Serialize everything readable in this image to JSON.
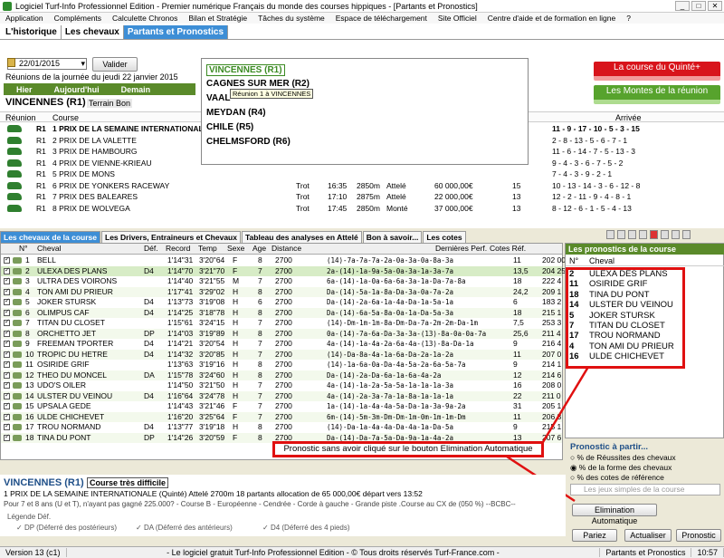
{
  "window": {
    "title": "Logiciel Turf-Info Professionnel Edition - Premier numérique Français du monde des courses hippiques - [Partants et Pronostics]"
  },
  "menu": [
    "Application",
    "Compléments",
    "Calculette Chronos",
    "Bilan et Stratégie",
    "Tâches du système",
    "Espace de téléchargement",
    "Site Officiel",
    "Centre d'aide et de formation en ligne",
    "?"
  ],
  "tabs": [
    "L'historique",
    "Les chevaux",
    "Partants et Pronostics"
  ],
  "date": {
    "value": "22/01/2015",
    "valider": "Valider"
  },
  "reunions_text": "Réunions de la journée du jeudi 22 janvier 2015",
  "nav": {
    "hier": "Hier",
    "aujourdhui": "Aujourd'hui",
    "demain": "Demain"
  },
  "venue": {
    "title": "VINCENNES (R1)",
    "terrain": "Terrain Bon"
  },
  "race_table": {
    "headers": [
      "Réunion",
      "Course",
      "Arrivée"
    ],
    "rows": [
      {
        "reunion": "R1",
        "course": "1 PRIX DE LA SEMAINE INTERNATIONALE",
        "type": "",
        "time": "",
        "dist": "",
        "mode": "",
        "prize": "",
        "partants": "",
        "arrivee": "11 - 9 - 17 - 10 - 5 - 3 - 15"
      },
      {
        "reunion": "R1",
        "course": "2 PRIX DE LA VALETTE",
        "type": "",
        "time": "",
        "dist": "",
        "mode": "",
        "prize": "",
        "partants": "",
        "arrivee": "2 - 8 - 13 - 5 - 6 - 7 - 1"
      },
      {
        "reunion": "R1",
        "course": "3 PRIX DE HAMBOURG",
        "type": "",
        "time": "",
        "dist": "",
        "mode": "",
        "prize": "",
        "partants": "",
        "arrivee": "11 - 6 - 14 - 7 - 5 - 13 - 3"
      },
      {
        "reunion": "R1",
        "course": "4 PRIX DE VIENNE-KRIEAU",
        "type": "",
        "time": "",
        "dist": "",
        "mode": "",
        "prize": "",
        "partants": "",
        "arrivee": "9 - 4 - 3 - 6 - 7 - 5 - 2"
      },
      {
        "reunion": "R1",
        "course": "5 PRIX DE MONS",
        "type": "",
        "time": "",
        "dist": "",
        "mode": "",
        "prize": "",
        "partants": "",
        "arrivee": "7 - 4 - 3 - 9 - 2 - 1"
      },
      {
        "reunion": "R1",
        "course": "6 PRIX DE YONKERS RACEWAY",
        "type": "Trot",
        "time": "16:35",
        "dist": "2850m",
        "mode": "Attelé",
        "prize": "60 000,00€",
        "partants": "15",
        "arrivee": "10 - 13 - 14 - 3 - 6 - 12 - 8"
      },
      {
        "reunion": "R1",
        "course": "7 PRIX DES BALEARES",
        "type": "Trot",
        "time": "17:10",
        "dist": "2875m",
        "mode": "Attelé",
        "prize": "22 000,00€",
        "partants": "13",
        "arrivee": "12 - 2 - 11 - 9 - 4 - 8 - 1"
      },
      {
        "reunion": "R1",
        "course": "8 PRIX DE WOLVEGA",
        "type": "Trot",
        "time": "17:45",
        "dist": "2850m",
        "mode": "Monté",
        "prize": "37 000,00€",
        "partants": "13",
        "arrivee": "8 - 12 - 6 - 1 - 5 - 4 - 13"
      }
    ]
  },
  "popup": {
    "items": [
      "VINCENNES (R1)",
      "CAGNES SUR MER (R2)",
      "VAAL",
      "MEYDAN (R4)",
      "CHILE (R5)",
      "CHELMSFORD (R6)"
    ],
    "tooltip": "Réunion 1 à VINCENNES"
  },
  "quinte_button": "La course du Quinté+",
  "montes_button": "Les Montes de la réunion",
  "mid_tabs": [
    "Les chevaux de la course",
    "Les Drivers, Entraineurs et Chevaux",
    "Tableau des analyses en Attelé",
    "Bon à savoir...",
    "Les cotes"
  ],
  "horse_grid": {
    "headers": [
      "N°",
      "Cheval",
      "Déf.",
      "Record",
      "Temp",
      "Sexe",
      "Age",
      "Distance",
      "Dernières Perf.",
      "Cotes Réf."
    ],
    "rows": [
      {
        "n": "1",
        "name": "BELL",
        "def": "",
        "record": "1'14\"31",
        "temp": "3'20\"64",
        "sexe": "F",
        "age": "8",
        "dist": "2700",
        "perf": "(14)-7a-7a-7a-2a-0a-3a-0a-8a-3a",
        "cote": "11",
        "extra": "202 00"
      },
      {
        "n": "2",
        "name": "ULEXA DES PLANS",
        "def": "D4",
        "record": "1'14\"70",
        "temp": "3'21\"70",
        "sexe": "F",
        "age": "7",
        "dist": "2700",
        "perf": "2a-(14)-1a-9a-5a-0a-3a-1a-3a-7a",
        "cote": "13,5",
        "extra": "204 25"
      },
      {
        "n": "3",
        "name": "ULTRA DES VOIRONS",
        "def": "",
        "record": "1'14\"40",
        "temp": "3'21\"55",
        "sexe": "M",
        "age": "7",
        "dist": "2700",
        "perf": "6a-(14)-1a-0a-6a-6a-3a-1a-Da-7a-8a",
        "cote": "18",
        "extra": "222 4"
      },
      {
        "n": "4",
        "name": "TON AMI DU PRIEUR",
        "def": "",
        "record": "1'17\"41",
        "temp": "3'29\"02",
        "sexe": "H",
        "age": "8",
        "dist": "2700",
        "perf": "Da-(14)-5a-1a-8a-Da-3a-0a-7a-2a",
        "cote": "24,2",
        "extra": "209 1"
      },
      {
        "n": "5",
        "name": "JOKER STURSK",
        "def": "D4",
        "record": "1'13\"73",
        "temp": "3'19\"08",
        "sexe": "H",
        "age": "6",
        "dist": "2700",
        "perf": "Da-(14)-2a-6a-1a-4a-Da-1a-5a-1a",
        "cote": "6",
        "extra": "183 2"
      },
      {
        "n": "6",
        "name": "OLIMPUS CAF",
        "def": "D4",
        "record": "1'14\"25",
        "temp": "3'18\"78",
        "sexe": "H",
        "age": "8",
        "dist": "2700",
        "perf": "Da-(14)-6a-5a-8a-0a-1a-Da-5a-3a",
        "cote": "18",
        "extra": "215 1"
      },
      {
        "n": "7",
        "name": "TITAN DU CLOSET",
        "def": "",
        "record": "1'15\"61",
        "temp": "3'24\"15",
        "sexe": "H",
        "age": "7",
        "dist": "2700",
        "perf": "(14)-Dm-1m-1m-8a-Dm-Da-7a-2m-2m-Da-1m",
        "cote": "7,5",
        "extra": "253 3"
      },
      {
        "n": "8",
        "name": "ORCHETTO JET",
        "def": "DP",
        "record": "1'14\"03",
        "temp": "3'19\"89",
        "sexe": "H",
        "age": "8",
        "dist": "2700",
        "perf": "0a-(14)-7a-6a-Da-3a-3a-(13)-8a-0a-0a-7a",
        "cote": "25,6",
        "extra": "211 4"
      },
      {
        "n": "9",
        "name": "FREEMAN TPORTER",
        "def": "D4",
        "record": "1'14\"21",
        "temp": "3'20\"54",
        "sexe": "H",
        "age": "7",
        "dist": "2700",
        "perf": "4a-(14)-1a-4a-2a-6a-4a-(13)-8a-Da-1a",
        "cote": "9",
        "extra": "216 4"
      },
      {
        "n": "10",
        "name": "TROPIC DU HETRE",
        "def": "D4",
        "record": "1'14\"32",
        "temp": "3'20\"85",
        "sexe": "H",
        "age": "7",
        "dist": "2700",
        "perf": "(14)-Da-8a-4a-1a-6a-Da-2a-1a-2a",
        "cote": "11",
        "extra": "207 0"
      },
      {
        "n": "11",
        "name": "OSIRIDE GRIF",
        "def": "",
        "record": "1'13\"63",
        "temp": "3'19\"16",
        "sexe": "H",
        "age": "8",
        "dist": "2700",
        "perf": "(14)-1a-6a-0a-Da-4a-5a-2a-6a-5a-7a",
        "cote": "9",
        "extra": "214 1"
      },
      {
        "n": "12",
        "name": "THEO DU MONCEL",
        "def": "DA",
        "record": "1'15\"78",
        "temp": "3'24\"60",
        "sexe": "H",
        "age": "8",
        "dist": "2700",
        "perf": "Da-(14)-2a-Da-6a-1a-6a-4a-2a",
        "cote": "12",
        "extra": "214 6"
      },
      {
        "n": "13",
        "name": "UDO'S OILER",
        "def": "",
        "record": "1'14\"50",
        "temp": "3'21\"50",
        "sexe": "H",
        "age": "7",
        "dist": "2700",
        "perf": "4a-(14)-1a-2a-5a-5a-1a-1a-1a-3a",
        "cote": "16",
        "extra": "208 0"
      },
      {
        "n": "14",
        "name": "ULSTER DU VEINOU",
        "def": "D4",
        "record": "1'16\"64",
        "temp": "3'24\"78",
        "sexe": "H",
        "age": "7",
        "dist": "2700",
        "perf": "4a-(14)-2a-3a-7a-1a-8a-1a-1a-1a",
        "cote": "22",
        "extra": "211 0"
      },
      {
        "n": "15",
        "name": "UPSALA GEDE",
        "def": "",
        "record": "1'14\"43",
        "temp": "3'21\"46",
        "sexe": "F",
        "age": "7",
        "dist": "2700",
        "perf": "1a-(14)-1a-4a-4a-5a-Da-1a-3a-9a-2a",
        "cote": "31",
        "extra": "205 1"
      },
      {
        "n": "16",
        "name": "ULDE CHICHEVET",
        "def": "",
        "record": "1'16\"20",
        "temp": "3'25\"64",
        "sexe": "F",
        "age": "7",
        "dist": "2700",
        "perf": "6m-(14)-5m-3m-Dm-Dm-1m-0m-1m-1m-Dm",
        "cote": "11",
        "extra": "206 3"
      },
      {
        "n": "17",
        "name": "TROU NORMAND",
        "def": "D4",
        "record": "1'13\"77",
        "temp": "3'19\"18",
        "sexe": "H",
        "age": "8",
        "dist": "2700",
        "perf": "(14)-Da-1a-4a-4a-Da-4a-1a-Da-5a",
        "cote": "9",
        "extra": "215 1"
      },
      {
        "n": "18",
        "name": "TINA DU PONT",
        "def": "DP",
        "record": "1'14\"26",
        "temp": "3'20\"59",
        "sexe": "F",
        "age": "8",
        "dist": "2700",
        "perf": "Da-(14)-Da-7a-5a-Da-9a-1a-4a-2a",
        "cote": "13",
        "extra": "207 6"
      }
    ]
  },
  "prono": {
    "title": "Les pronostics de la course",
    "headers": [
      "N°",
      "Cheval"
    ],
    "items": [
      {
        "n": "2",
        "name": "ULEXA DES PLANS"
      },
      {
        "n": "11",
        "name": "OSIRIDE GRIF"
      },
      {
        "n": "18",
        "name": "TINA DU PONT"
      },
      {
        "n": "14",
        "name": "ULSTER DU VEINOU"
      },
      {
        "n": "5",
        "name": "JOKER STURSK"
      },
      {
        "n": "7",
        "name": "TITAN DU CLOSET"
      },
      {
        "n": "17",
        "name": "TROU NORMAND"
      },
      {
        "n": "4",
        "name": "TON AMI DU PRIEUR"
      },
      {
        "n": "16",
        "name": "ULDE CHICHEVET"
      }
    ]
  },
  "annotation": "Pronostic sans avoir cliqué sur le bouton Elimination Automatique",
  "pronostic_partir": {
    "title": "Pronostic à partir...",
    "options": [
      "% de Réussites des chevaux",
      "% de la forme des chevaux",
      "% des cotes de référence"
    ],
    "jeux_placeholder": "Les jeux simples de la course",
    "elimination": "Elimination Automatique",
    "pariez": "Pariez",
    "actualiser": "Actualiser",
    "pronostic": "Pronostic"
  },
  "bottom_info": {
    "venue": "VINCENNES (R1)",
    "difficulty": "Course très difficile",
    "line1": "1 PRIX DE LA SEMAINE INTERNATIONALE (Quinté) Attelé 2700m 18 partants allocation de 65 000,00€ départ vers 13:52",
    "line2": "Pour 7 et 8 ans (U et T), n'ayant pas gagné 225.000? - Course B - Européenne - Cendrée - Corde à gauche - Grande piste .Course au CX de (050 %) --BCBC--",
    "legend_title": "Légende Déf.",
    "legend_dp": "DP (Déferré des postérieurs)",
    "legend_da": "DA (Déferré des antérieurs)",
    "legend_d4": "D4 (Déferré des 4 pieds)"
  },
  "statusbar": {
    "version": "Version 13 (c1)",
    "center": "- Le logiciel gratuit Turf-Info Professionnel Edition - © Tous droits réservés Turf-France.com -",
    "section": "Partants et Pronostics",
    "time": "10:57"
  }
}
